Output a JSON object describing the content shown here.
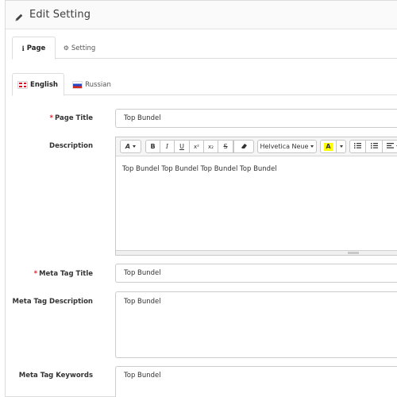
{
  "header": {
    "title": "Edit Setting",
    "icon": "pencil-icon"
  },
  "tabs": [
    {
      "label": "Page",
      "icon": "info-icon",
      "active": true
    },
    {
      "label": "Setting",
      "icon": "gear-icon",
      "active": false
    }
  ],
  "languages": [
    {
      "label": "English",
      "flag": "uk-flag-icon",
      "active": true
    },
    {
      "label": "Russian",
      "flag": "russia-flag-icon",
      "active": false
    }
  ],
  "form": {
    "page_title": {
      "label": "Page Title",
      "required": "*",
      "value": "Top Bundel"
    },
    "description": {
      "label": "Description",
      "content": "Top Bundel Top Bundel Top Bundel Top Bundel",
      "toolbar": {
        "style": "A",
        "bold": "B",
        "italic": "I",
        "underline": "U",
        "superscript": "x²",
        "subscript": "x₂",
        "strikethrough": "S",
        "font_family": "Helvetica Neue",
        "color": "A"
      }
    },
    "meta_title": {
      "label": "Meta Tag Title",
      "required": "*",
      "value": "Top Bundel"
    },
    "meta_description": {
      "label": "Meta Tag Description",
      "value": "Top Bundel"
    },
    "meta_keywords": {
      "label": "Meta Tag Keywords",
      "value": "Top Bundel"
    }
  },
  "colors": {
    "required": "#e0242d",
    "highlight": "#ffff00",
    "border": "#cccccc"
  }
}
